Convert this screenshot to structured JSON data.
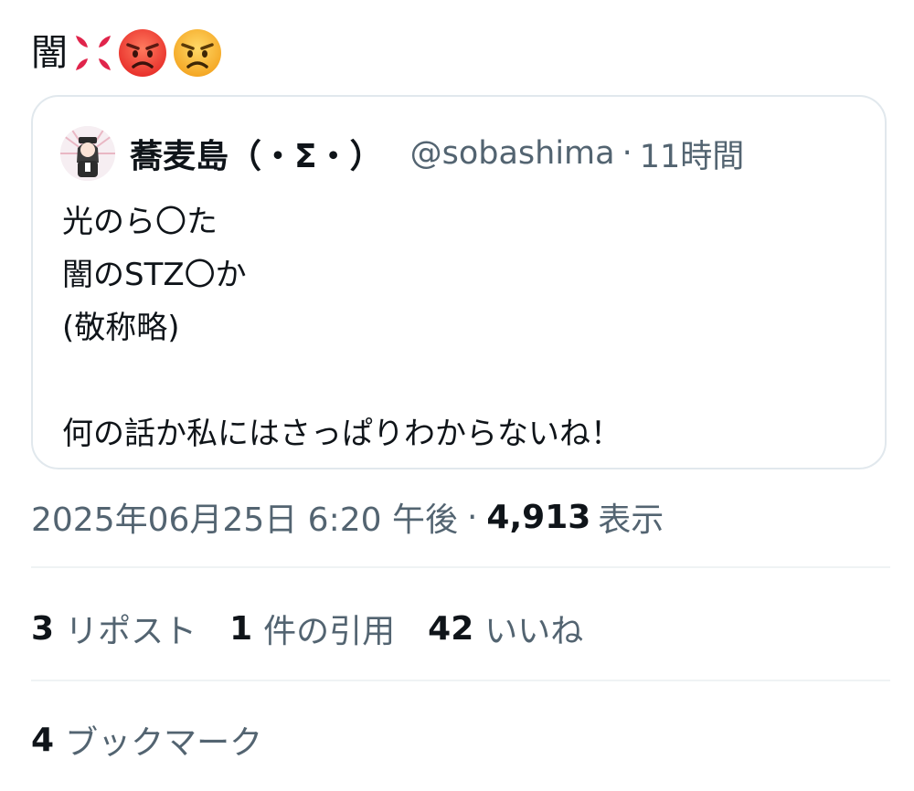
{
  "tweet": {
    "text": "闇",
    "emojis": [
      {
        "icon": "anger-symbol-icon",
        "color": "#e0244b"
      },
      {
        "icon": "pouting-face-icon",
        "color": "#f0453a"
      },
      {
        "icon": "angry-face-icon",
        "color": "#f8b133"
      }
    ]
  },
  "quote": {
    "name": "蕎麦島（・Σ・）",
    "handle": "@sobashima",
    "separator": "·",
    "time": "11時間",
    "lines": [
      "光のら〇た",
      "闇のSTZ〇か",
      "(敬称略)",
      "",
      "何の話か私にはさっぱりわからないね！"
    ]
  },
  "meta": {
    "datetime": "2025年06月25日 6:20 午後",
    "separator": "·",
    "views_count": "4,913",
    "views_label": "表示"
  },
  "stats": [
    {
      "count": "3",
      "label": "リポスト"
    },
    {
      "count": "1",
      "label": "件の引用"
    },
    {
      "count": "42",
      "label": "いいね"
    }
  ],
  "bookmarks": {
    "count": "4",
    "label": "ブックマーク"
  },
  "colors": {
    "text_primary": "#0f1419",
    "text_secondary": "#536471",
    "border": "#e1e8ed"
  }
}
